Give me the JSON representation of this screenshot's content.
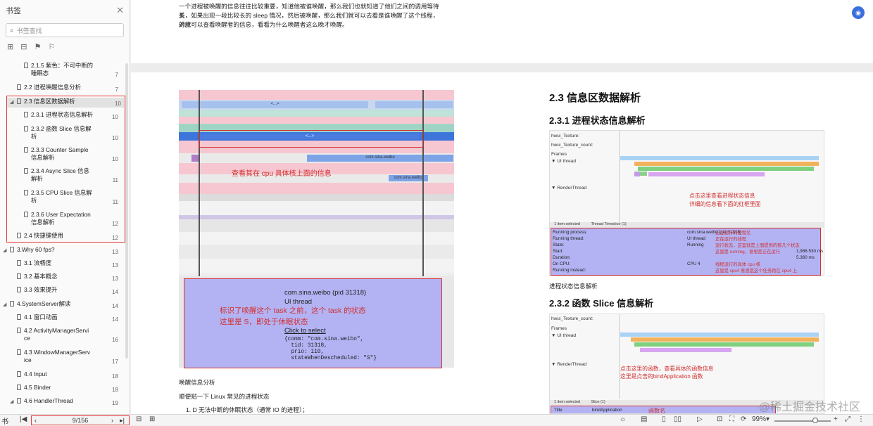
{
  "sidebar": {
    "title": "书签",
    "search_placeholder": "书签查找",
    "items": [
      {
        "label": "2.1.5 紫色：不可中断的",
        "label2": "睡眠态",
        "page": "7"
      },
      {
        "label": "2.2 进程唤醒信息分析",
        "page": "7"
      },
      {
        "label": "2.3 信息区数据解析",
        "page": "10"
      },
      {
        "label": "2.3.1 进程状态信息解析",
        "page": "10"
      },
      {
        "label": "2.3.2 函数 Slice 信息解",
        "label2": "析",
        "page": "10"
      },
      {
        "label": "2.3.3 Counter Sample",
        "label2": "信息解析",
        "page": "10"
      },
      {
        "label": "2.3.4 Async Slice 信息",
        "label2": "解析",
        "page": "11"
      },
      {
        "label": "2.3.5 CPU Slice 信息解",
        "label2": "析",
        "page": "11"
      },
      {
        "label": "2.3.6 User Expectation",
        "label2": "信息解析",
        "page": "12"
      },
      {
        "label": "2.4 快捷键使用",
        "page": "12"
      },
      {
        "label": "3.Why 60 fps?",
        "page": "13"
      },
      {
        "label": "3.1 流畅度",
        "page": "13"
      },
      {
        "label": "3.2 基本概念",
        "page": "13"
      },
      {
        "label": "3.3 效果提升",
        "page": "14"
      },
      {
        "label": "4.SystemServer解读",
        "page": "14"
      },
      {
        "label": "4.1 窗口动画",
        "page": "14"
      },
      {
        "label": "4.2 ActivityManagerServi",
        "label2": "ce",
        "page": "16"
      },
      {
        "label": "4.3 WindowManagerServ",
        "label2": "ice",
        "page": "17"
      },
      {
        "label": "4.4 Input",
        "page": "18"
      },
      {
        "label": "4.5 Binder",
        "page": "18"
      },
      {
        "label": "4.6 HandlerThread",
        "page": "19"
      }
    ]
  },
  "document": {
    "intro_lines": [
      "一个进程被唤醒的信息往往比较重要，知道他被谁唤醒，那么我们也就知道了他们之间的调用等待关",
      "系，如果出现一段比较长的 sleep 情况，然后被唤醒，那么我们就可以去看是谁唤醒了这个线程，对应",
      "的就可以查看唤醒者的信息，看看为什么唤醒者这么晚才唤醒。"
    ],
    "left_figure": {
      "bar_labels": [
        "<...>",
        "<...>",
        "com.sina.weibo",
        "<...>",
        "com.sina.weibo"
      ],
      "annotation": "查看其在 cpu 具体核上面的信息",
      "popup": {
        "process": "com.sina.weibo (pid 31318)",
        "thread": "UI thread",
        "note1": "标识了唤醒这个 task 之前，这个 task 的状态",
        "note2": "这里是 S，即处于休眠状态",
        "link": "Click to select",
        "code": "{comm: \"com.sina.weibo\",\n  tid: 31318,\n  prio: 110,\n  stateWhenDescheduled: \"S\"}"
      }
    },
    "below_left": [
      "唤醒信息分析",
      "顺便贴一下 Linux 常见的进程状态",
      "1. D 无法中断的休眠状态（通常 IO 的进程）；"
    ],
    "section_h2": "2.3 信息区数据解析",
    "section_h3a": "2.3.1 进程状态信息解析",
    "fig1": {
      "tracks": [
        "hwui_Texture:",
        "hwui_Texture_count:",
        "Frames",
        "▼ UI thread",
        "▼ RenderThread"
      ],
      "bars": [
        "bindApplication",
        "SystemServiceRegistry manager get /data/app/com.sina.weibo-2/base.apk",
        "OpenDexFilesFromOat",
        "Open...",
        "Open oat file /data/app/com.sina.weibo-2/oat/arm/base.odex",
        "D..."
      ],
      "ann1": "点击这里查看进程状态信息",
      "ann2": "详细的信息看下面的红框里面",
      "tabs": [
        "1 item selected",
        "Thread Timeslice (1)"
      ],
      "details": [
        {
          "k": "Running process:",
          "v": "com.sina.weibo (pid 31318)",
          "note": "正在运行的进程名"
        },
        {
          "k": "Running thread:",
          "v": "UI thread",
          "note": "正在运行的线程"
        },
        {
          "k": "State:",
          "v": "Running",
          "note": "运行状态，这里就是上面提到的那几个状态"
        },
        {
          "k": "Start:",
          "v": "1,986.530 ms",
          "note": "这里是 running，意思是正在运行"
        },
        {
          "k": "Duration:",
          "v": "5.360 ms",
          "note": ""
        },
        {
          "k": "On CPU:",
          "v": "CPU 4",
          "note": "线程运行的具体 cpu 核"
        },
        {
          "k": "Running instead:",
          "v": "",
          "note": "这里是 cpu4 意思是这个任务跑在 cpu4 上"
        }
      ]
    },
    "caption1": "进程状态信息解析",
    "section_h3b": "2.3.2 函数 Slice 信息解析",
    "fig2": {
      "tracks": [
        "hwui_Texture_count:",
        "Frames",
        "▼ UI thread",
        "▼ RenderThread"
      ],
      "ann1": "点击这里的函数，查看具体的函数信息",
      "ann2": "这里是点击的bindApplication 函数",
      "tabs": [
        "1 item selected",
        "Slice (1)"
      ],
      "row_k": "Title",
      "row_v": "bindApplication",
      "row_note": "函数名"
    }
  },
  "statusbar": {
    "left_label": "书",
    "page_display": "9/156",
    "zoom": "99%",
    "watermark": "@稀土掘金技术社区"
  }
}
